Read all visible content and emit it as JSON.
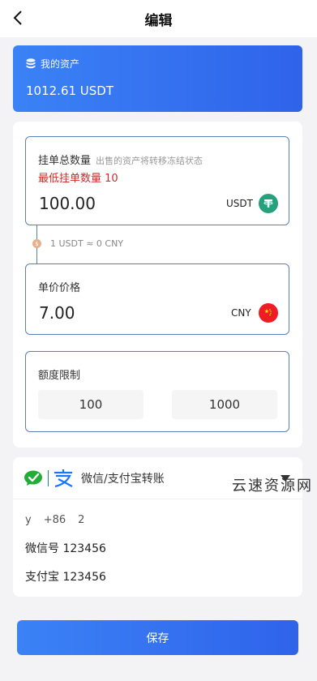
{
  "header": {
    "title": "编辑"
  },
  "asset": {
    "label": "我的资产",
    "value": "1012.61 USDT"
  },
  "quantity": {
    "label": "挂单总数量",
    "hint": "出售的资产将转移冻结状态",
    "min_text": "最低挂单数量 10",
    "value": "100.00",
    "unit": "USDT",
    "coin_icon": "tether-icon"
  },
  "rate": {
    "text": "1 USDT ≈ 0 CNY"
  },
  "price": {
    "label": "单价价格",
    "value": "7.00",
    "unit": "CNY",
    "flag_icon": "china-flag-icon"
  },
  "limit": {
    "label": "额度限制",
    "min": "100",
    "max": "1000"
  },
  "payment": {
    "title": "微信/支付宝转账",
    "user": {
      "name": "y",
      "code": "+86",
      "phone": "2"
    },
    "wechat_line": "微信号 123456",
    "alipay_line": "支付宝 123456"
  },
  "watermark": "云速资源网",
  "save_label": "保存",
  "colors": {
    "accent": "#2f63ea",
    "border": "#5b82b8",
    "danger": "#d42a2a",
    "tether": "#26a17b",
    "china_red": "#ee1c25",
    "wechat": "#22ac38",
    "alipay": "#1677ff"
  }
}
